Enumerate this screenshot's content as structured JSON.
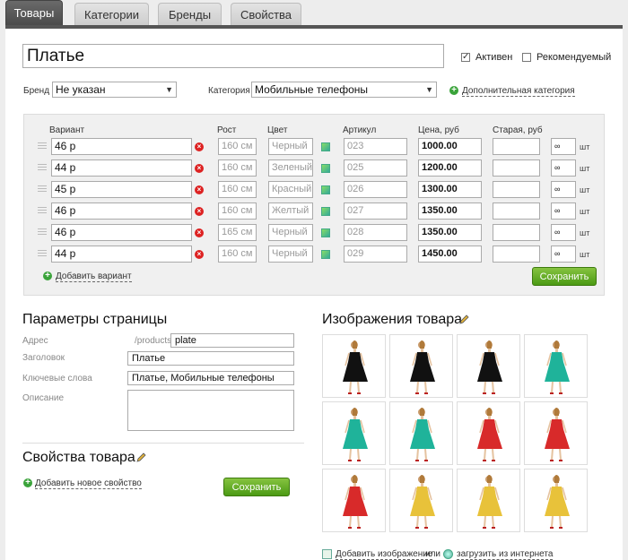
{
  "tabs": [
    {
      "label": "Товары",
      "active": true
    },
    {
      "label": "Категории",
      "active": false
    },
    {
      "label": "Бренды",
      "active": false
    },
    {
      "label": "Свойства",
      "active": false
    }
  ],
  "product": {
    "name": "Платье",
    "active_label": "Активен",
    "active_checked": true,
    "featured_label": "Рекомендуемый",
    "featured_checked": false
  },
  "brand": {
    "label": "Бренд",
    "value": "Не указан"
  },
  "category": {
    "label": "Категория",
    "value": "Мобильные телефоны",
    "add_link": "Дополнительная категория"
  },
  "variants": {
    "headers": {
      "variant": "Вариант",
      "height": "Рост",
      "color": "Цвет",
      "sku": "Артикул",
      "price": "Цена, руб",
      "old_price": "Старая, руб"
    },
    "rows": [
      {
        "name": "46 р",
        "height": "160 см",
        "color": "Черный",
        "sku": "023",
        "price": "1000.00",
        "old": "",
        "stock": "∞",
        "unit": "шт"
      },
      {
        "name": "44 р",
        "height": "160 см",
        "color": "Зеленый",
        "sku": "025",
        "price": "1200.00",
        "old": "",
        "stock": "∞",
        "unit": "шт"
      },
      {
        "name": "45 р",
        "height": "160 см",
        "color": "Красный",
        "sku": "026",
        "price": "1300.00",
        "old": "",
        "stock": "∞",
        "unit": "шт"
      },
      {
        "name": "46 р",
        "height": "160 см",
        "color": "Желтый",
        "sku": "027",
        "price": "1350.00",
        "old": "",
        "stock": "∞",
        "unit": "шт"
      },
      {
        "name": "46 р",
        "height": "165 см",
        "color": "Черный",
        "sku": "028",
        "price": "1350.00",
        "old": "",
        "stock": "∞",
        "unit": "шт"
      },
      {
        "name": "44 р",
        "height": "160 см",
        "color": "Черный",
        "sku": "029",
        "price": "1450.00",
        "old": "",
        "stock": "∞",
        "unit": "шт"
      }
    ],
    "add_label": "Добавить вариант",
    "save_label": "Сохранить"
  },
  "page_params": {
    "title": "Параметры страницы",
    "address_label": "Адрес",
    "address_prefix": "/products/",
    "address_value": "plate",
    "heading_label": "Заголовок",
    "heading_value": "Платье",
    "keywords_label": "Ключевые слова",
    "keywords_value": "Платье, Мобильные телефоны",
    "description_label": "Описание",
    "description_value": ""
  },
  "properties": {
    "title": "Свойства товара",
    "add_label": "Добавить новое свойство",
    "save_label": "Сохранить"
  },
  "images": {
    "title": "Изображения товара",
    "dress_colors": [
      "#111111",
      "#111111",
      "#111111",
      "#1fb39a",
      "#1fb39a",
      "#1fb39a",
      "#d82a2a",
      "#d82a2a",
      "#d82a2a",
      "#e8c23a",
      "#e8c23a",
      "#e8c23a"
    ],
    "add_label": "Добавить изображение",
    "or_label": "или",
    "upload_label": "загрузить из интернета"
  },
  "colors": {
    "accent_green": "#4b9a14",
    "tab_active": "#555555"
  }
}
